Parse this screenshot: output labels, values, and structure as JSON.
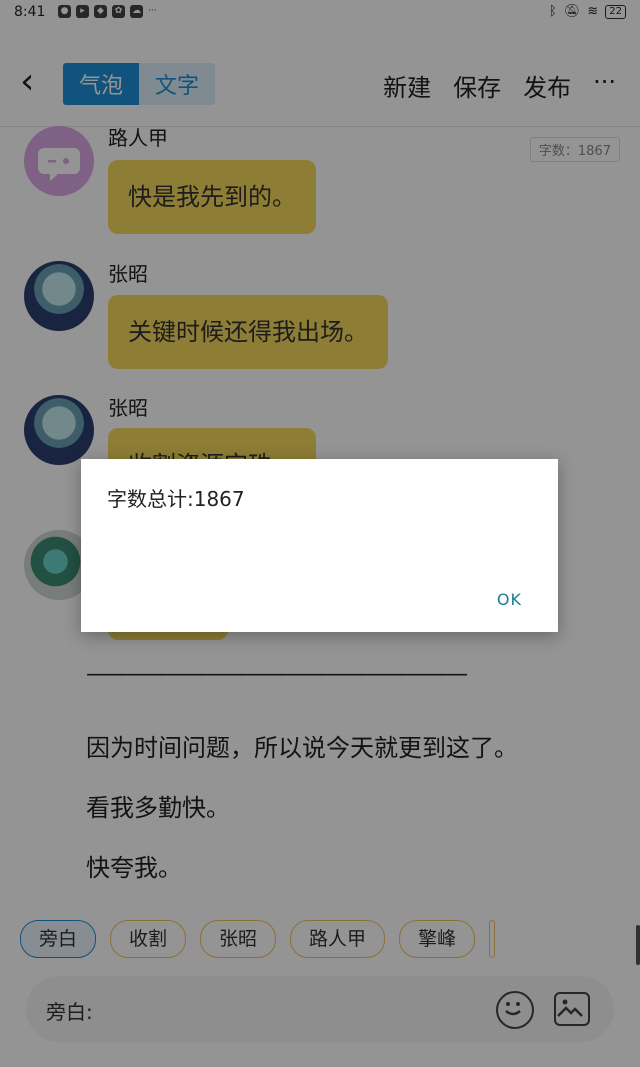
{
  "status": {
    "time": "8:41",
    "more": "···",
    "battery": "22"
  },
  "toolbar": {
    "tab_bubble": "气泡",
    "tab_text": "文字",
    "new": "新建",
    "save": "保存",
    "publish": "发布",
    "more": "···"
  },
  "word_count_badge": "字数：1867",
  "messages": [
    {
      "name": "路人甲",
      "text": "快是我先到的。"
    },
    {
      "name": "张昭",
      "text": "关键时候还得我出场。"
    },
    {
      "name": "张昭",
      "text": "收割资源宝珠。"
    }
  ],
  "divider_line": "———————————————————",
  "paragraphs": [
    "因为时间问题，所以说今天就更到这了。",
    "看我多勤快。",
    "快夸我。"
  ],
  "chips": [
    "旁白",
    "收割",
    "张昭",
    "路人甲",
    "擎峰"
  ],
  "input_label": "旁白:",
  "dialog": {
    "message": "字数总计:1867",
    "ok": "OK"
  }
}
